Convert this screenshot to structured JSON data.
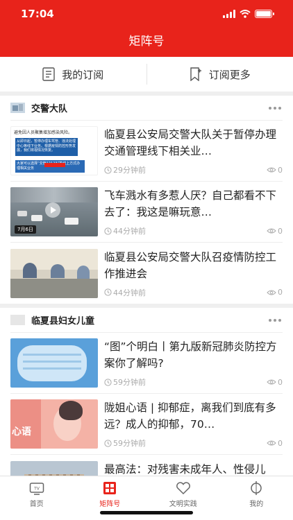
{
  "status": {
    "time": "17:04"
  },
  "header": {
    "title": "矩阵号"
  },
  "subscribe_bar": {
    "my_subscriptions": "我的订阅",
    "subscribe_more": "订阅更多"
  },
  "sections": [
    {
      "name": "交警大队",
      "articles": [
        {
          "title": "临夏县公安局交警大队关于暂停办理交通管理线下相关业…",
          "time": "29分钟前",
          "views": "0"
        },
        {
          "title": "飞车溅水有多惹人厌？自己都看不下去了：我这是嘛玩意…",
          "time": "44分钟前",
          "views": "0"
        },
        {
          "title": "临夏县公安局交警大队召疫情防控工作推进会",
          "time": "44分钟前",
          "views": "0"
        }
      ]
    },
    {
      "name": "临夏县妇女儿童",
      "articles": [
        {
          "title": "“图”个明白丨第九版新冠肺炎防控方案你了解吗?",
          "time": "59分钟前",
          "views": "0"
        },
        {
          "title": "陇姐心语 | 抑郁症，离我们到底有多远？成人的抑郁，70…",
          "time": "59分钟前",
          "views": "0"
        },
        {
          "title": "最高法：对残害未成年人、性侵儿童，保真妇女儿童等惩",
          "time": "",
          "views": ""
        }
      ]
    }
  ],
  "thumb_text": {
    "notice_top": "避免因人员聚集增加感染风险。",
    "notice_mid": "从即日起，暂停办理车驾管、违法处理中心等线下业务。根据疫情防控形势发展，我们将视情况恢复。",
    "notice_bottom": "大家可以选择“交管12123”等线上方式办理相关业务",
    "video_date": "7月6日",
    "health_label": "心语"
  },
  "tabbar": [
    {
      "label": "首页"
    },
    {
      "label": "矩阵号"
    },
    {
      "label": "文明实践"
    },
    {
      "label": "我的"
    }
  ],
  "colors": {
    "brand": "#e8231b",
    "meta": "#aaaaaa"
  }
}
